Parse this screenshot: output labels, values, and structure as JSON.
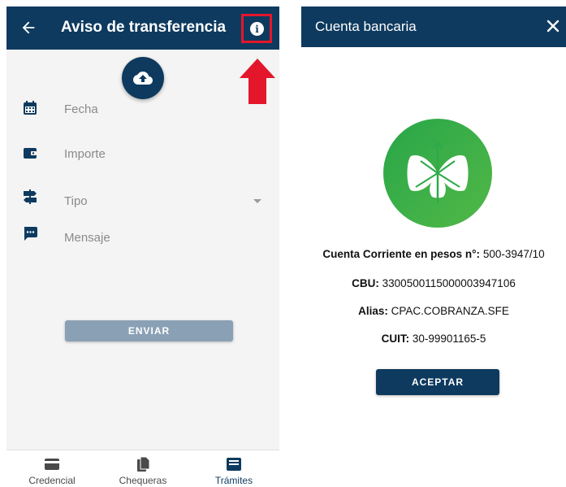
{
  "left_screen": {
    "title": "Aviso de transferencia",
    "back_icon": "arrow-left-icon",
    "info_icon": "info-circle-icon",
    "upload_icon": "cloud-upload-icon",
    "fields": [
      {
        "label": "Fecha",
        "icon": "calendar-icon"
      },
      {
        "label": "Importe",
        "icon": "wallet-icon"
      },
      {
        "label": "Tipo",
        "icon": "signpost-icon"
      },
      {
        "label": "Mensaje",
        "icon": "message-icon"
      }
    ],
    "send_label": "ENVIAR",
    "bottom_nav": [
      {
        "label": "Credencial",
        "icon": "card-icon",
        "active": false
      },
      {
        "label": "Chequeras",
        "icon": "documents-icon",
        "active": false
      },
      {
        "label": "Trámites",
        "icon": "inbox-icon",
        "active": true
      }
    ]
  },
  "right_screen": {
    "title": "Cuenta bancaria",
    "close_icon": "close-icon",
    "logo_icon": "bank-logo-icon",
    "account": {
      "label": "Cuenta Corriente en pesos n°:",
      "value": "500-3947/10"
    },
    "cbu": {
      "label": "CBU:",
      "value": "3300500115000003947106"
    },
    "alias": {
      "label": "Alias:",
      "value": "CPAC.COBRANZA.SFE"
    },
    "cuit": {
      "label": "CUIT:",
      "value": "30-99901165-5"
    },
    "accept_label": "ACEPTAR"
  },
  "colors": {
    "primary": "#0e3a5f",
    "highlight_red": "#e4162b",
    "logo_green": "#2eaa4a",
    "disabled_button": "#8aa0b4"
  }
}
